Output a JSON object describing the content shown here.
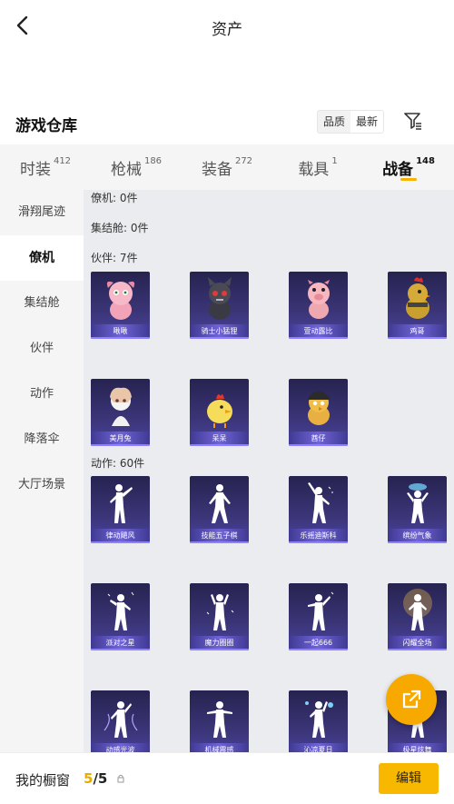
{
  "header": {
    "title": "资产",
    "back_icon": "back-chevron-icon"
  },
  "warehouse": {
    "title": "游戏仓库",
    "sort_options": [
      "品质",
      "最新"
    ],
    "filter_icon": "filter-icon"
  },
  "tabs": [
    {
      "label": "时装",
      "count": "412",
      "active": false
    },
    {
      "label": "枪械",
      "count": "186",
      "active": false
    },
    {
      "label": "装备",
      "count": "272",
      "active": false
    },
    {
      "label": "载具",
      "count": "1",
      "active": false
    },
    {
      "label": "战备",
      "count": "148",
      "active": true
    }
  ],
  "sidebar": [
    {
      "label": "滑翔尾迹",
      "active": false
    },
    {
      "label": "僚机",
      "active": true
    },
    {
      "label": "集结舱",
      "active": false
    },
    {
      "label": "伙伴",
      "active": false
    },
    {
      "label": "动作",
      "active": false
    },
    {
      "label": "降落伞",
      "active": false
    },
    {
      "label": "大厅场景",
      "active": false
    }
  ],
  "sections": {
    "wingman": "僚机: 0件",
    "pod": "集结舱: 0件",
    "partner": "伙伴: 7件",
    "action": "动作: 60件"
  },
  "partners": [
    "啾啾",
    "骑士小猛狸",
    "萱动露比",
    "鸡哥",
    "美月兔",
    "呆呆",
    "酋仔"
  ],
  "actions": [
    "律动飓风",
    "技能五子棋",
    "乐摇迪斯科",
    "缤纷气象",
    "派对之星",
    "魔力圈圈",
    "一起666",
    "闪耀全场",
    "动感光波",
    "机械震感",
    "沁凉夏日",
    "极星炫舞"
  ],
  "footer": {
    "label": "我的橱窗",
    "current": "5",
    "total": "/5",
    "edit_label": "编辑"
  },
  "fab_icon": "share-icon"
}
